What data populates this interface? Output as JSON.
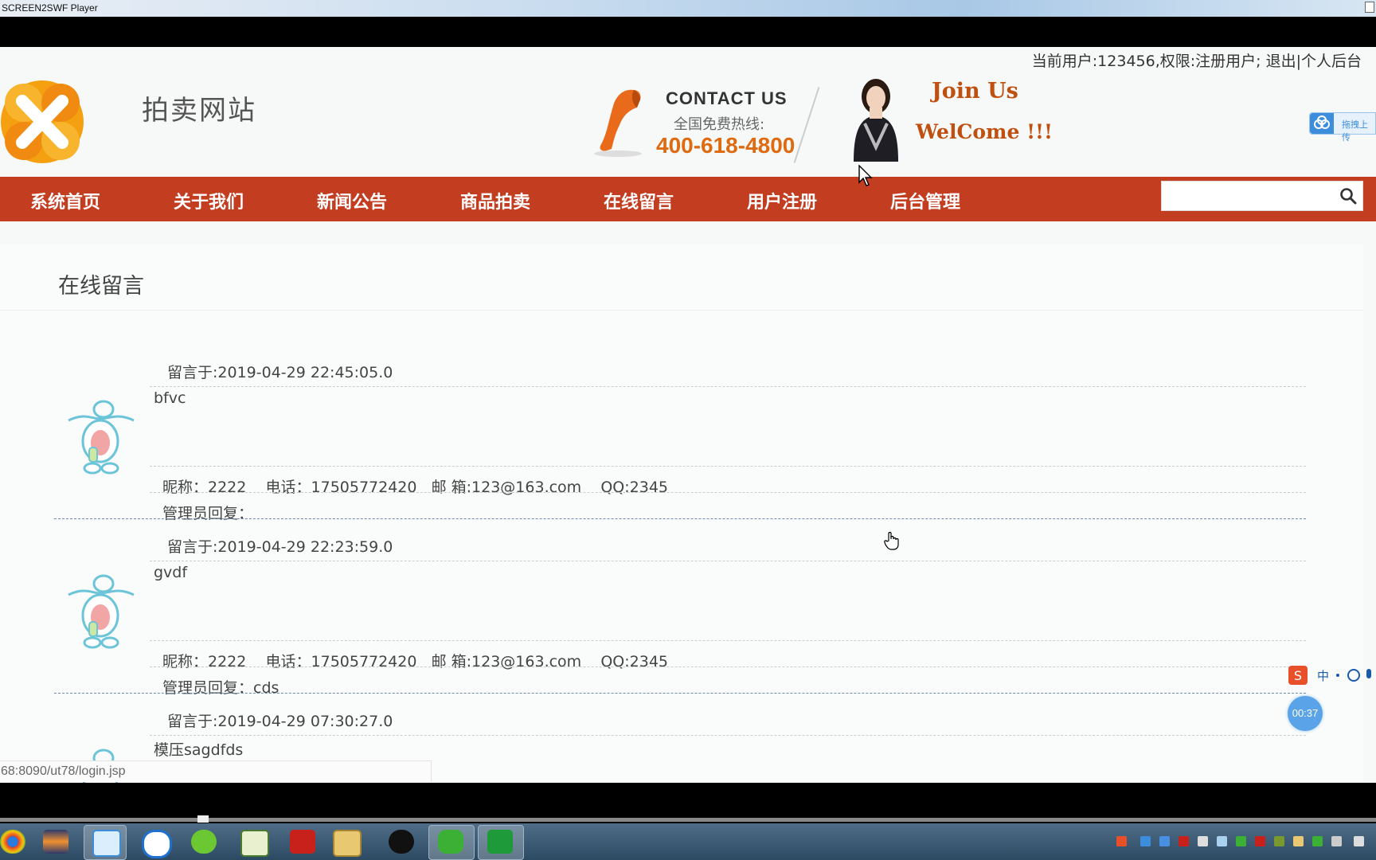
{
  "window": {
    "title": "SCREEN2SWF Player"
  },
  "header": {
    "user_info": "当前用户:123456,权限:注册用户; 退出|个人后台",
    "site_name": "拍卖网站",
    "contact_title": "CONTACT US",
    "hotline_label": "全国免费热线:",
    "hotline_number": "400-618-4800",
    "join_text": "Join Us",
    "welcome_text": "WelCome !!!",
    "cloud_button_label": "拖拽上传"
  },
  "nav": {
    "items": [
      {
        "label": "系统首页"
      },
      {
        "label": "关于我们"
      },
      {
        "label": "新闻公告"
      },
      {
        "label": "商品拍卖"
      },
      {
        "label": "在线留言"
      },
      {
        "label": "用户注册"
      },
      {
        "label": "后台管理"
      }
    ],
    "search_placeholder": ""
  },
  "main": {
    "section_title": "在线留言",
    "messages": [
      {
        "time": "留言于:2019-04-29 22:45:05.0",
        "body": "bfvc",
        "info": "昵称：2222    电话：17505772420   邮 箱:123@163.com    QQ:2345",
        "reply": "管理员回复："
      },
      {
        "time": "留言于:2019-04-29 22:23:59.0",
        "body": "gvdf",
        "info": "昵称：2222    电话：17505772420   邮 箱:123@163.com    QQ:2345",
        "reply": "管理员回复：cds"
      },
      {
        "time": "留言于:2019-04-29 07:30:27.0",
        "body": "模压sagdfds",
        "info": "",
        "reply": ""
      }
    ]
  },
  "status_bar": {
    "url": "68:8090/ut78/login.jsp"
  },
  "overlay": {
    "timer": "00:37",
    "ime_label": "中"
  },
  "colors": {
    "nav_bg": "#c33d20",
    "accent_orange": "#e06a10"
  }
}
